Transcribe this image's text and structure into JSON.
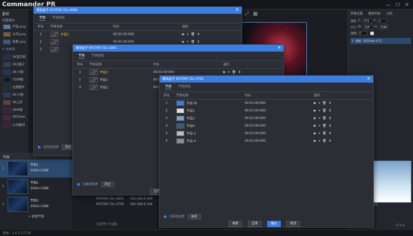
{
  "app": {
    "logo": "Commander PR",
    "version": "版本：2.6.0.17138"
  },
  "left_panel": {
    "header": "素材",
    "tree_label": "内置素材",
    "items": [
      {
        "label": "产品.png"
      },
      {
        "label": "公司.png"
      },
      {
        "label": "背景.png"
      },
      {
        "label": "文件夹"
      },
      {
        "label": "2K显示屏"
      },
      {
        "label": "2K1窗口"
      },
      {
        "label": "2K-小窗"
      },
      {
        "label": "720P图"
      },
      {
        "label": "过渡图片"
      },
      {
        "label": "2K-小窗"
      },
      {
        "label": "3K上升"
      },
      {
        "label": "2K中窗"
      },
      {
        "label": "2K2Fake"
      },
      {
        "label": "公司素材"
      }
    ]
  },
  "program_list": {
    "header": "节目",
    "items": [
      {
        "num": "1",
        "name": "节目1",
        "res": "1920×1080"
      },
      {
        "num": "2",
        "name": "节目2",
        "res": "1920×1080"
      },
      {
        "num": "3",
        "name": "节目3",
        "res": "1920×1080"
      }
    ],
    "new_label": "+ 新建节目"
  },
  "right_panel": {
    "tabs": [
      "参数设置",
      "播放列表",
      "分组"
    ],
    "fields": [
      {
        "label": "坐标",
        "x": "X:",
        "xval": "470",
        "y": "Y:",
        "yval": "0"
      },
      {
        "label": "大小",
        "x": "W:",
        "xval": "320",
        "y": "H:",
        "yval": "1080"
      },
      {
        "label": "透明",
        "x": "",
        "xval": "0",
        "y": "",
        "yval": ""
      }
    ],
    "row": {
      "num": "1",
      "type": "视频",
      "name": "2K2Fake II CF..."
    },
    "preview_caption": "25",
    "caption2": "CF0.0"
  },
  "window1": {
    "title": "播放盒子-KYSTAR-72x-0066",
    "tabs": [
      "节目",
      "节目排程"
    ],
    "headers": [
      "序号",
      "节目名称",
      "时长",
      "操作"
    ],
    "rows": [
      {
        "num": "1",
        "name": "节目3",
        "dur": "00:01:00:000",
        "ops": "▶ ⏸ 🗑 ⬇"
      },
      {
        "num": "2",
        "name": "",
        "dur": "00:01:00:000",
        "ops": "▶ ⏸ 🗑 ⬇"
      },
      {
        "num": "3",
        "name": "",
        "dur": "00:01:00:000",
        "ops": "▶ ⏸ 🗑 ⬇"
      }
    ],
    "sync_label": "已开启同步",
    "close_btn": "开启"
  },
  "window2": {
    "title": "播放盒子-KYSTAR-72x-3001",
    "tabs": [
      "节目",
      "节目排程"
    ],
    "headers": [
      "序号",
      "节目名称",
      "时长",
      "操作"
    ],
    "rows": [
      {
        "num": "1",
        "name": "节目3",
        "dur": "00:01:00:000",
        "ops": "▶ ⏸ 🗑 ⬇"
      },
      {
        "num": "2",
        "name": "节目1",
        "dur": "00:01:00:000",
        "ops": "▶ ⏸ 🗑 ⬇"
      },
      {
        "num": "3",
        "name": "节目2",
        "dur": "00:01:00:000",
        "ops": "▶ ⏸ 🗑 ⬇"
      }
    ],
    "sync_label": "已关闭同步",
    "close_btn": "开启",
    "apply_btn": "应用"
  },
  "window3": {
    "title": "播放盒子-KYSTAR-72x-3750",
    "tabs": [
      "节目",
      "节目排程"
    ],
    "headers": [
      "序号",
      "节目名称",
      "时长",
      "操作"
    ],
    "rows": [
      {
        "num": "1",
        "name": "节目-内",
        "dur": "00:01:00:000",
        "ops": "▶ ⏸ 🗑 ⬇"
      },
      {
        "num": "2",
        "name": "节目1",
        "dur": "00:01:00:000",
        "ops": "▶ ⏸ 🗑 ⬇"
      },
      {
        "num": "3",
        "name": "节目2",
        "dur": "00:01:00:000",
        "ops": "▶ ⏸ 🗑 ⬇"
      },
      {
        "num": "4",
        "name": "节目4",
        "dur": "00:01:00:000",
        "ops": "▶ ⏸ 🗑 ⬇"
      },
      {
        "num": "5",
        "name": "节目-3",
        "dur": "00:01:00:000",
        "ops": "▶ ⏸ 🗑 ⬇"
      },
      {
        "num": "6",
        "name": "节目-4",
        "dur": "00:01:00:000",
        "ops": "▶ ⏸ 🗑 ⬇"
      }
    ],
    "sync_label": "已开启同步",
    "close_btn": "关闭",
    "footer": [
      "刷新",
      "应用",
      "确认",
      "取消"
    ]
  },
  "devices": [
    {
      "name": "KYSTAR-72x-3001",
      "ip": "192.168.0.209"
    },
    {
      "name": "KYSTAR-72x-3750",
      "ip": "192.168.0.104"
    }
  ],
  "selection_count": "已选中1个设备"
}
